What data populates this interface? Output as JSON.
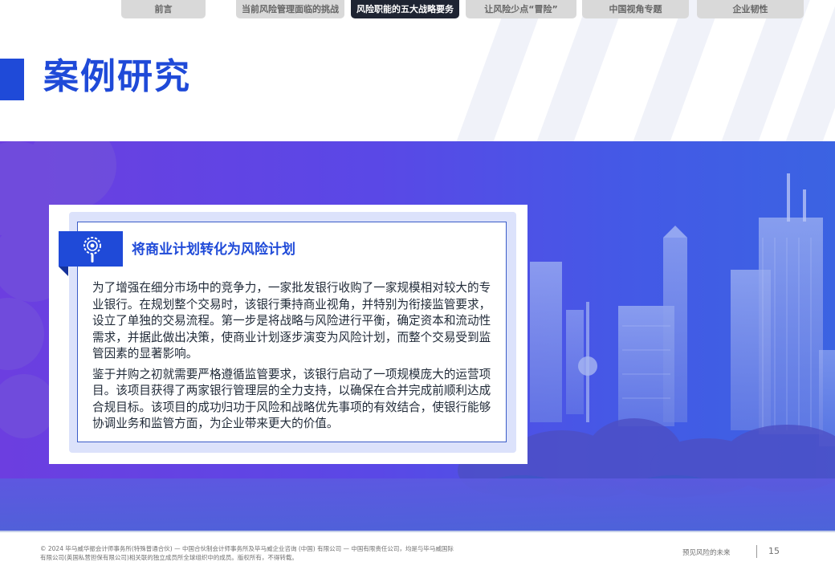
{
  "nav": {
    "tabs": [
      {
        "label": "前言",
        "active": false
      },
      {
        "label": "当前风险管理面临的挑战",
        "active": false
      },
      {
        "label": "风险职能的五大战略要务",
        "active": true
      },
      {
        "label": "让风险少点“冒险”",
        "active": false
      },
      {
        "label": "中国视角专题",
        "active": false
      },
      {
        "label": "企业韧性",
        "active": false
      }
    ]
  },
  "page": {
    "title": "案例研究"
  },
  "card": {
    "icon": "gear-magnifier-icon",
    "heading": "将商业计划转化为风险计划",
    "paragraphs": [
      "为了增强在细分市场中的竞争力，一家批发银行收购了一家规模相对较大的专业银行。在规划整个交易时，该银行秉持商业视角，并特别为衔接监管要求，设立了单独的交易流程。第一步是将战略与风险进行平衡，确定资本和流动性需求，并据此做出决策，使商业计划逐步演变为风险计划，而整个交易受到监管因素的显著影响。",
      "鉴于并购之初就需要严格遵循监管要求，该银行启动了一项规模庞大的运营项目。该项目获得了两家银行管理层的全力支持，以确保在合并完成前顺利达成合规目标。该项目的成功归功于风险和战略优先事项的有效结合，使银行能够协调业务和监管方面，为企业带来更大的价值。"
    ]
  },
  "footer": {
    "copyright_line1": "© 2024 毕马威华振会计师事务所(特殊普通合伙) — 中国合伙制会计师事务所及毕马威企业咨询 (中国) 有限公司 — 中国有限责任公司，均是与毕马威国际",
    "copyright_line2": "有限公司(英国私营担保有限公司)相关联的独立成员所全球组织中的成员。版权所有，不得转载。",
    "tagline": "预见风险的未来",
    "page_number": "15"
  },
  "colors": {
    "brand_blue": "#1f4ad8",
    "active_tab": "#1e2432",
    "tab": "#d9d9d9",
    "hero_left": "#6c3ee0",
    "hero_right": "#3b63e2"
  }
}
